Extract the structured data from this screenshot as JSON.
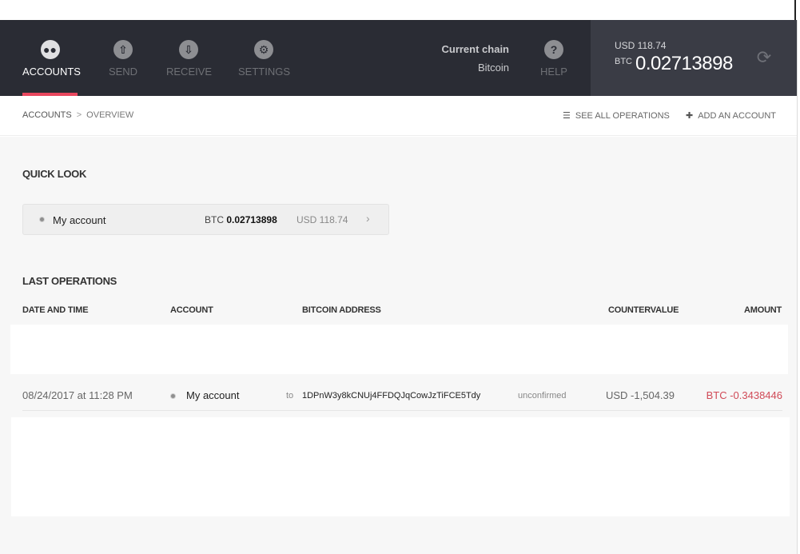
{
  "nav": {
    "tabs": [
      {
        "label": "ACCOUNTS",
        "icon": "accounts-icon",
        "active": true
      },
      {
        "label": "SEND",
        "icon": "send-icon",
        "active": false
      },
      {
        "label": "RECEIVE",
        "icon": "receive-icon",
        "active": false
      },
      {
        "label": "SETTINGS",
        "icon": "settings-icon",
        "active": false
      }
    ],
    "help_label": "HELP",
    "chain_title": "Current chain",
    "chain_value": "Bitcoin"
  },
  "balance": {
    "usd": "USD 118.74",
    "btc_label": "BTC",
    "btc_value": "0.02713898"
  },
  "breadcrumb": {
    "root": "ACCOUNTS",
    "separator": ">",
    "current": "OVERVIEW"
  },
  "actions": {
    "see_all": "SEE ALL OPERATIONS",
    "add_account": "ADD AN ACCOUNT"
  },
  "quick_look": {
    "title": "QUICK LOOK",
    "account": {
      "name": "My account",
      "btc_label": "BTC",
      "btc_value": "0.02713898",
      "usd": "USD 118.74"
    }
  },
  "last_operations": {
    "title": "LAST OPERATIONS",
    "columns": [
      "DATE AND TIME",
      "ACCOUNT",
      "BITCOIN ADDRESS",
      "COUNTERVALUE",
      "AMOUNT"
    ],
    "rows": [
      {
        "date": "08/24/2017 at 11:28 PM",
        "account": "My account",
        "direction": "to",
        "address": "1DPnW3y8kCNUj4FFDQJqCowJzTiFCE5Tdy",
        "status": "unconfirmed",
        "countervalue": "USD -1,504.39",
        "amount": "BTC -0.3438446"
      }
    ]
  },
  "colors": {
    "nav_bg": "#2a2c34",
    "balance_bg": "#3a3c45",
    "accent": "#e8475e",
    "negative_amount": "#d04a57"
  }
}
